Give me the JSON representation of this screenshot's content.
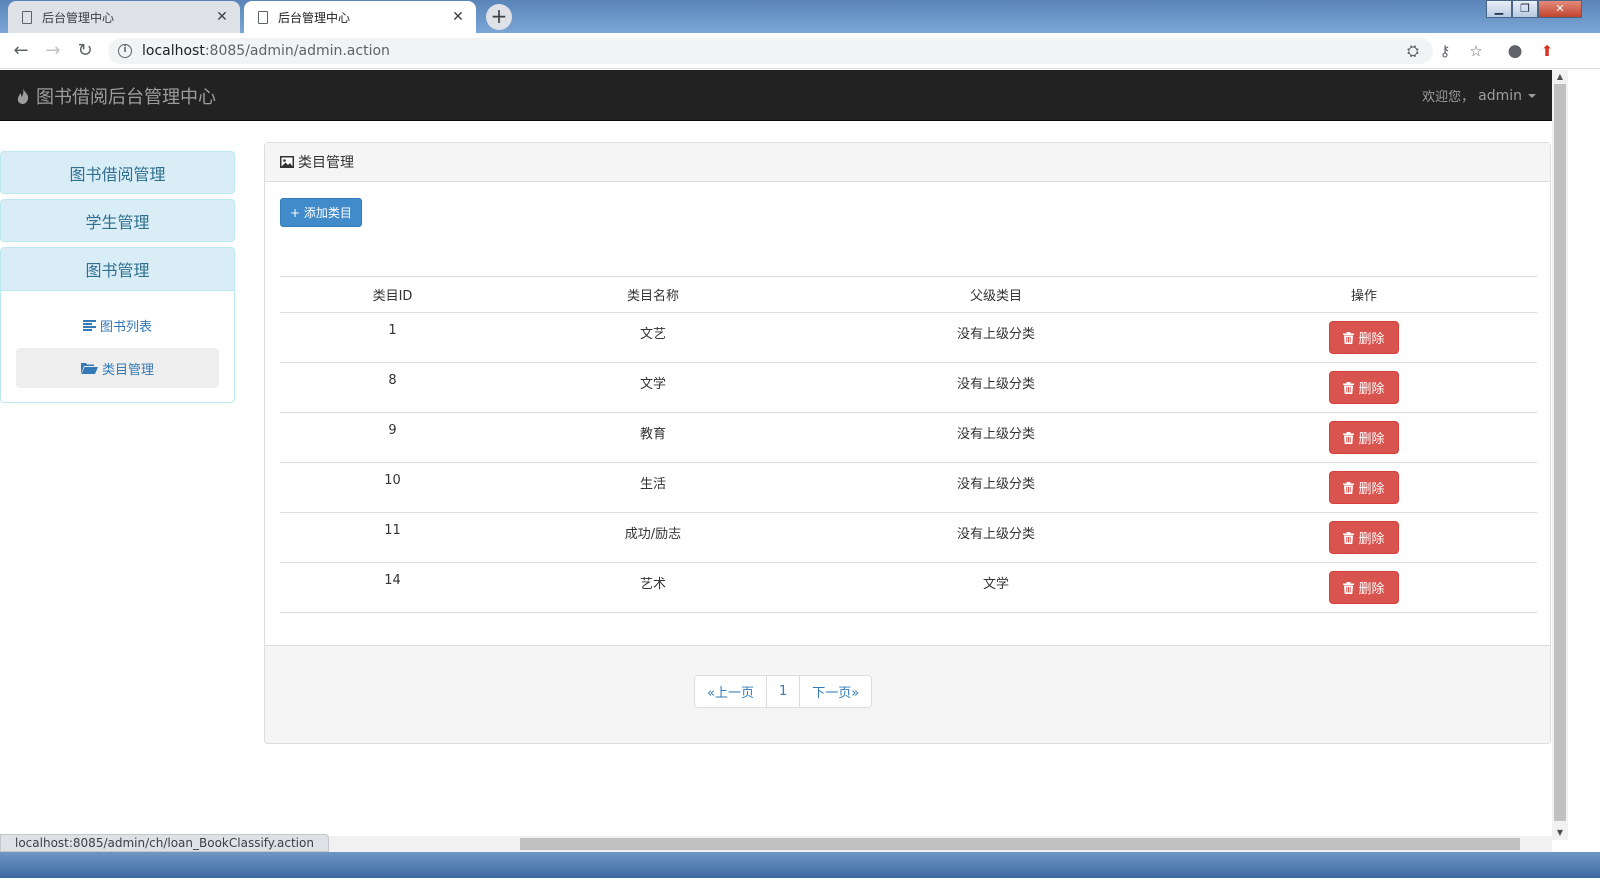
{
  "browser": {
    "tabs": [
      {
        "title": "后台管理中心",
        "active": false
      },
      {
        "title": "后台管理中心",
        "active": true
      }
    ],
    "url_host": "localhost",
    "url_rest": ":8085/admin/admin.action",
    "status_url": "localhost:8085/admin/ch/loan_BookClassify.action"
  },
  "app": {
    "brand": "图书借阅后台管理中心",
    "user": {
      "greeting": "欢迎您，",
      "name": "admin"
    }
  },
  "sidebar": {
    "groups": [
      {
        "label": "图书借阅管理"
      },
      {
        "label": "学生管理"
      },
      {
        "label": "图书管理",
        "items": [
          {
            "label": "图书列表",
            "active": false
          },
          {
            "label": "类目管理",
            "active": true
          }
        ]
      }
    ]
  },
  "panel": {
    "title": "类目管理",
    "add_button": "+ 添加类目",
    "columns": [
      "类目ID",
      "类目名称",
      "父级类目",
      "操作"
    ],
    "rows": [
      {
        "id": "1",
        "name": "文艺",
        "parent": "没有上级分类"
      },
      {
        "id": "8",
        "name": "文学",
        "parent": "没有上级分类"
      },
      {
        "id": "9",
        "name": "教育",
        "parent": "没有上级分类"
      },
      {
        "id": "10",
        "name": "生活",
        "parent": "没有上级分类"
      },
      {
        "id": "11",
        "name": "成功/励志",
        "parent": "没有上级分类"
      },
      {
        "id": "14",
        "name": "艺术",
        "parent": "文学"
      }
    ],
    "delete_label": "删除",
    "pagination": {
      "prev": "«上一页",
      "current": "1",
      "next": "下一页»"
    }
  },
  "colors": {
    "navbar": "#222222",
    "sidebar_head": "#d9edf7",
    "primary": "#428bca",
    "danger": "#d9534f"
  }
}
